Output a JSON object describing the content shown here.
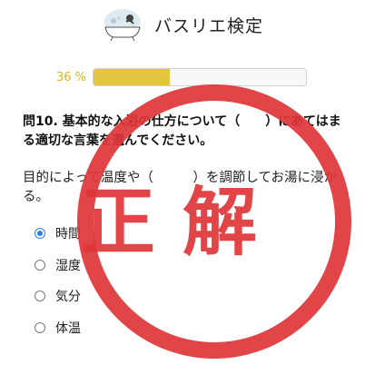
{
  "header": {
    "title": "バスリエ検定",
    "logo_icon": "bathtub-logo-icon"
  },
  "progress": {
    "label": "36 %",
    "value": 0.36
  },
  "question": {
    "text": "問10. 基本的な入浴の仕方について（　　）にあてはまる適切な言葉を選んでください。"
  },
  "prompt": {
    "text": "目的によって温度や（　　　）を調節してお湯に浸かる。"
  },
  "options": [
    {
      "label": "時間",
      "selected": true
    },
    {
      "label": "湿度",
      "selected": false
    },
    {
      "label": "気分",
      "selected": false
    },
    {
      "label": "体温",
      "selected": false
    }
  ],
  "result": {
    "stamp_text": "正解",
    "color": "#de3538"
  },
  "colors": {
    "accent": "#e3c53f",
    "progress_text": "#d8b520",
    "radio_selected": "#2f7de2"
  }
}
